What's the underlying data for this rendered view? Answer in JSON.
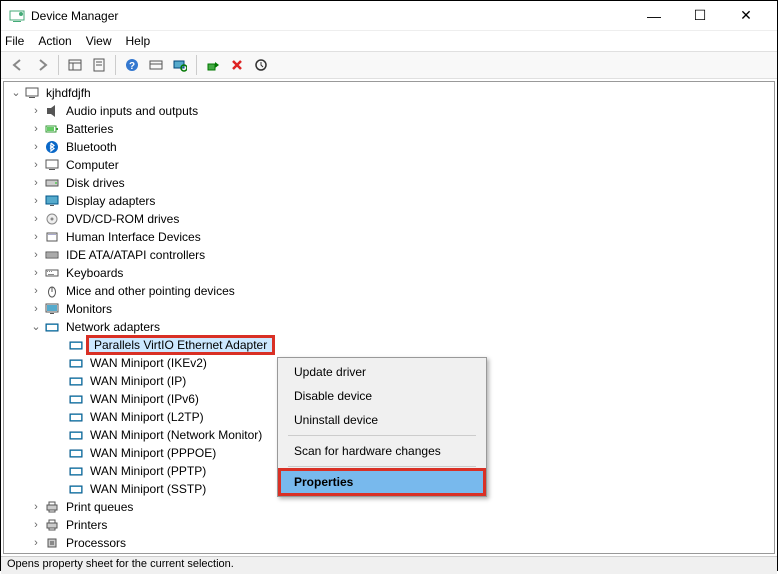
{
  "window_title": "Device Manager",
  "menu": {
    "file": "File",
    "action": "Action",
    "view": "View",
    "help": "Help"
  },
  "statusbar_text": "Opens property sheet for the current selection.",
  "tree": {
    "root": "kjhdfdjfh",
    "categories": [
      {
        "icon": "audio",
        "label": "Audio inputs and outputs"
      },
      {
        "icon": "battery",
        "label": "Batteries"
      },
      {
        "icon": "bluetooth",
        "label": "Bluetooth"
      },
      {
        "icon": "computer",
        "label": "Computer"
      },
      {
        "icon": "disk",
        "label": "Disk drives"
      },
      {
        "icon": "display",
        "label": "Display adapters"
      },
      {
        "icon": "dvd",
        "label": "DVD/CD-ROM drives"
      },
      {
        "icon": "hid",
        "label": "Human Interface Devices"
      },
      {
        "icon": "ide",
        "label": "IDE ATA/ATAPI controllers"
      },
      {
        "icon": "keyboard",
        "label": "Keyboards"
      },
      {
        "icon": "mouse",
        "label": "Mice and other pointing devices"
      },
      {
        "icon": "monitor",
        "label": "Monitors"
      }
    ],
    "network": {
      "label": "Network adapters",
      "children": [
        "Parallels VirtIO Ethernet Adapter",
        "WAN Miniport (IKEv2)",
        "WAN Miniport (IP)",
        "WAN Miniport (IPv6)",
        "WAN Miniport (L2TP)",
        "WAN Miniport (Network Monitor)",
        "WAN Miniport (PPPOE)",
        "WAN Miniport (PPTP)",
        "WAN Miniport (SSTP)"
      ]
    },
    "after": [
      {
        "icon": "printer",
        "label": "Print queues"
      },
      {
        "icon": "printer",
        "label": "Printers"
      },
      {
        "icon": "cpu",
        "label": "Processors"
      }
    ]
  },
  "context_menu": {
    "items": [
      "Update driver",
      "Disable device",
      "Uninstall device"
    ],
    "scan": "Scan for hardware changes",
    "properties": "Properties"
  }
}
